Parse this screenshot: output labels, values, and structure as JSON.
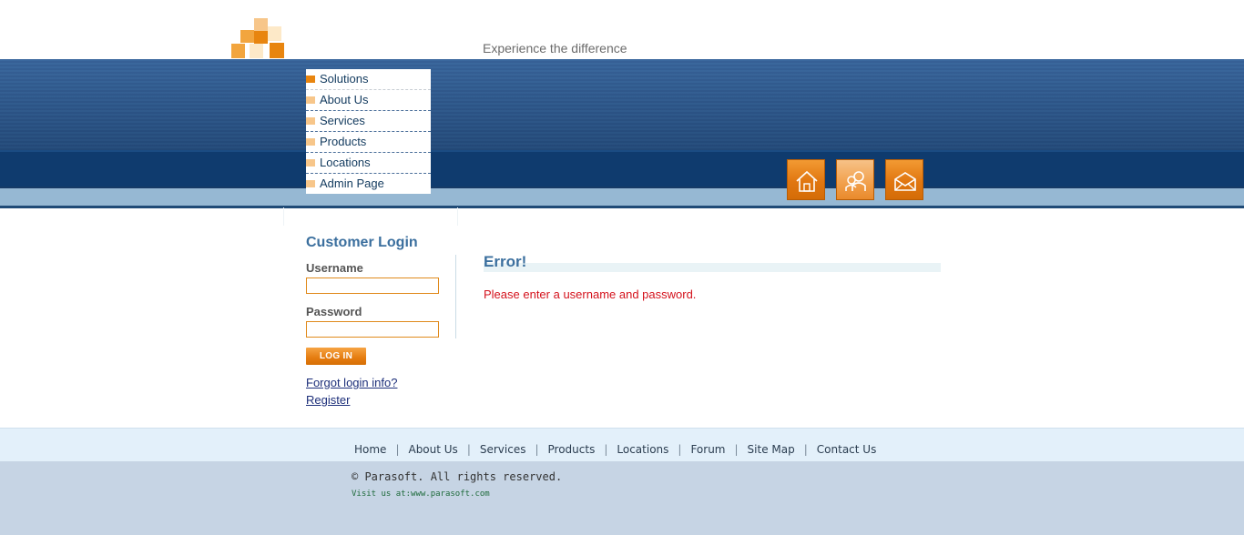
{
  "header": {
    "tagline": "Experience the difference",
    "logo_icon": "orange-block-grid-logo",
    "colors": {
      "brand_orange": "#e8850f",
      "light_orange": "#f7c68a",
      "band_blue": "#2f5f98",
      "dark_blue": "#0f3b6e"
    }
  },
  "nav": {
    "items": [
      {
        "label": "Solutions",
        "active": true
      },
      {
        "label": "About Us"
      },
      {
        "label": "Services"
      },
      {
        "label": "Products"
      },
      {
        "label": "Locations"
      },
      {
        "label": "Admin Page"
      }
    ]
  },
  "icons": [
    {
      "name": "home-icon"
    },
    {
      "name": "users-icon"
    },
    {
      "name": "envelope-icon"
    }
  ],
  "login": {
    "title": "Customer Login",
    "username_label": "Username",
    "username_value": "",
    "password_label": "Password",
    "password_value": "",
    "button_label": "LOG IN",
    "forgot_link": "Forgot login info?",
    "register_link": "Register"
  },
  "main": {
    "title": "Error!",
    "message": "Please enter a username and password.",
    "message_color": "#d4121c"
  },
  "footer": {
    "links": [
      "Home",
      "About Us",
      "Services",
      "Products",
      "Locations",
      "Forum",
      "Site Map",
      "Contact Us"
    ],
    "copyright": "© Parasoft. All rights reserved.",
    "visit": "Visit us at:www.parasoft.com"
  }
}
